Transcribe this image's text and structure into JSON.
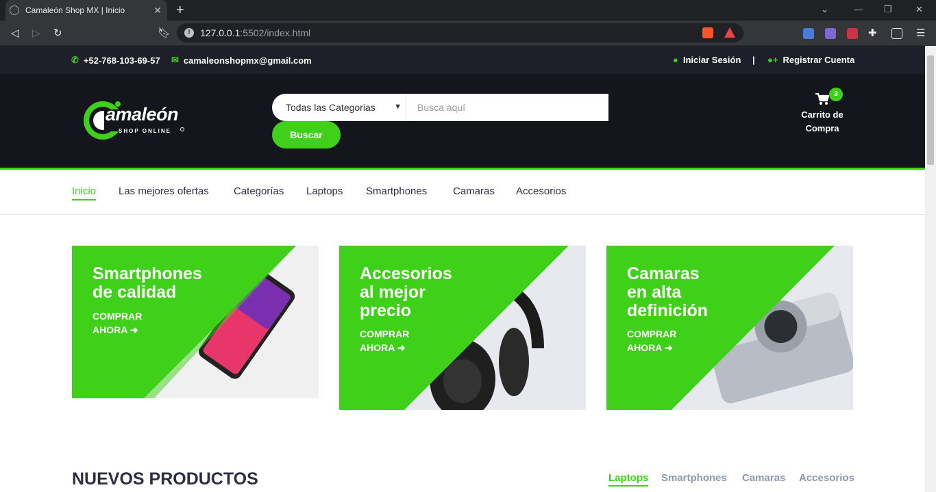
{
  "browser": {
    "tab_title": "Camaleón Shop MX | Inicio",
    "url_host": "127.0.0.1",
    "url_rest": ":5502/index.html"
  },
  "topbar": {
    "phone": "+52-768-103-69-57",
    "email": "camaleonshopmx@gmail.com",
    "login": "Iniciar Sesión",
    "separator": "|",
    "register": "Registrar Cuenta"
  },
  "header": {
    "logo_text": "amaleón",
    "logo_sub": "SHOP ONLINE",
    "category_select": "Todas las Categorias",
    "search_placeholder": "Busca aquí",
    "search_button": "Buscar",
    "cart_count": "3",
    "cart_line1": "Carrito de",
    "cart_line2": "Compra"
  },
  "nav": {
    "items": [
      "Inicio",
      "Las mejores ofertas",
      "Categorías",
      "Laptops",
      "Smartphones",
      "Camaras",
      "Accesorios"
    ]
  },
  "cards": [
    {
      "title_l1": "Smartphones",
      "title_l2": "de calidad",
      "title_l3": "",
      "cta_l1": "COMPRAR",
      "cta_l2": "AHORA"
    },
    {
      "title_l1": "Accesorios",
      "title_l2": "al mejor",
      "title_l3": "precio",
      "cta_l1": "COMPRAR",
      "cta_l2": "AHORA"
    },
    {
      "title_l1": "Camaras",
      "title_l2": "en alta",
      "title_l3": "definición",
      "cta_l1": "COMPRAR",
      "cta_l2": "AHORA"
    }
  ],
  "new_products": {
    "title": "NUEVOS PRODUCTOS",
    "tabs": [
      "Laptops",
      "Smartphones",
      "Camaras",
      "Accesorios"
    ]
  },
  "colors": {
    "accent": "#3fd11a",
    "dark": "#15161d",
    "topbar": "#1e1f29"
  }
}
